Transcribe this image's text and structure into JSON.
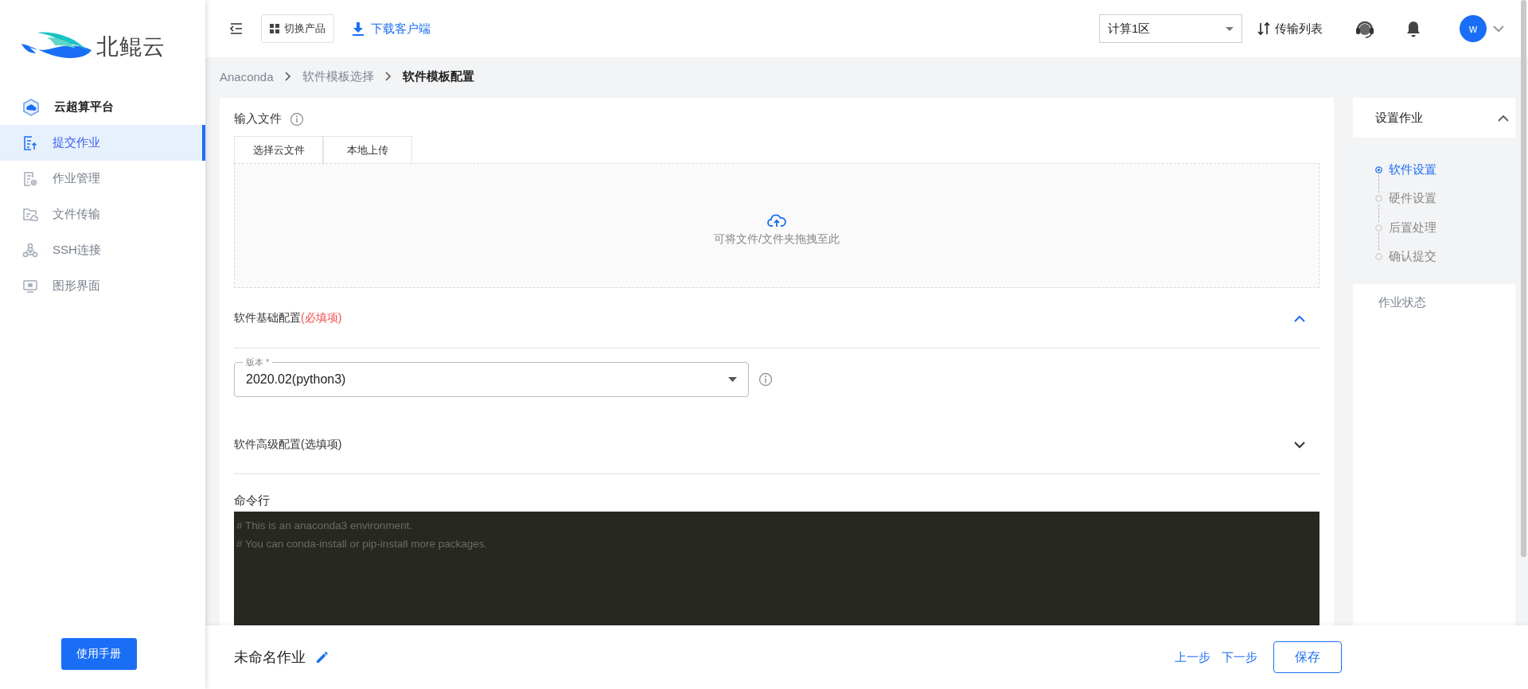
{
  "logo": {
    "text": "北鲲云"
  },
  "sidebar": {
    "items": [
      {
        "kind": "heading",
        "label": "云超算平台",
        "selected": false
      },
      {
        "kind": "link",
        "label": "提交作业",
        "selected": true
      },
      {
        "kind": "link",
        "label": "作业管理",
        "selected": false
      },
      {
        "kind": "link",
        "label": "文件传输",
        "selected": false
      },
      {
        "kind": "link",
        "label": "SSH连接",
        "selected": false
      },
      {
        "kind": "link",
        "label": "图形界面",
        "selected": false
      }
    ],
    "manual_button": "使用手册"
  },
  "topbar": {
    "switch_product": "切换产品",
    "download_client": "下载客户端",
    "region": "计算1区",
    "transfer_list": "传输列表",
    "avatar": "w"
  },
  "breadcrumb": [
    {
      "label": "Anaconda",
      "current": false
    },
    {
      "label": "软件模板选择",
      "current": false
    },
    {
      "label": "软件模板配置",
      "current": true
    }
  ],
  "form": {
    "input_files": {
      "label": "输入文件",
      "tabs": [
        "选择云文件",
        "本地上传"
      ],
      "drop_hint": "可将文件/文件夹拖拽至此"
    },
    "basic": {
      "title": "软件基础配置",
      "note": "(必填项)",
      "expanded": true
    },
    "version": {
      "label": "版本 *",
      "value": "2020.02(python3)"
    },
    "advanced": {
      "title": "软件高级配置(选填项)",
      "expanded": false
    },
    "command": {
      "label": "命令行",
      "lines": [
        "# This is an anaconda3 environment.",
        "# You can conda-install or pip-install more packages."
      ]
    }
  },
  "side_panel": {
    "title": "设置作业",
    "expanded": true,
    "steps": [
      {
        "label": "软件设置",
        "selected": true
      },
      {
        "label": "硬件设置",
        "selected": false
      },
      {
        "label": "后置处理",
        "selected": false
      },
      {
        "label": "确认提交",
        "selected": false
      }
    ],
    "status_title": "作业状态"
  },
  "footer": {
    "job_name": "未命名作业",
    "prev": "上一步",
    "next": "下一步",
    "save": "保存"
  }
}
